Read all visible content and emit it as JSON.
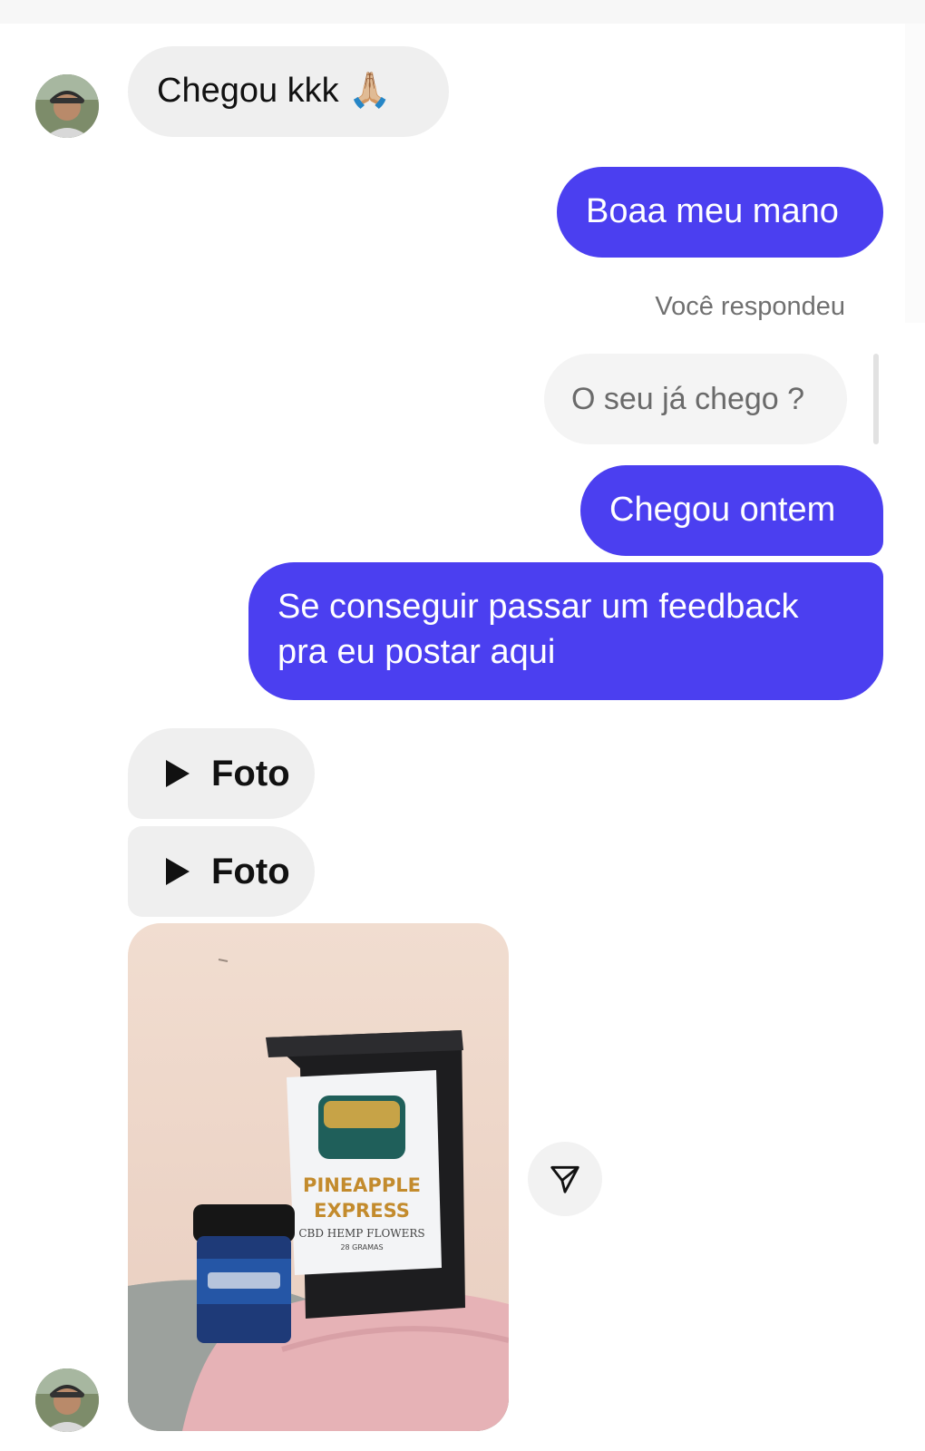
{
  "messages": {
    "incoming_1": {
      "text": "Chegou kkk 🙏🏼"
    },
    "outgoing_1": {
      "text": "Boaa meu mano"
    },
    "reply_caption": "Você respondeu",
    "quoted": {
      "text": "O seu já chego ?"
    },
    "outgoing_2": {
      "text": "Chegou ontem"
    },
    "outgoing_3": {
      "line1": "Se conseguir passar um feedback",
      "line2": "pra eu postar aqui"
    },
    "media_1": {
      "label": "Foto"
    },
    "media_2": {
      "label": "Foto"
    }
  },
  "photo": {
    "bag_title_1": "PINEAPPLE",
    "bag_title_2": "EXPRESS",
    "bag_subtitle": "CBD HEMP FLOWERS",
    "bag_weight": "28 GRAMAS"
  },
  "icons": {
    "avatar": "avatar",
    "play": "play-icon",
    "share": "send-icon"
  },
  "colors": {
    "outgoing_bubble": "#4b3ff0",
    "incoming_bubble": "#efefef",
    "reply_text": "#6a6a6a"
  }
}
